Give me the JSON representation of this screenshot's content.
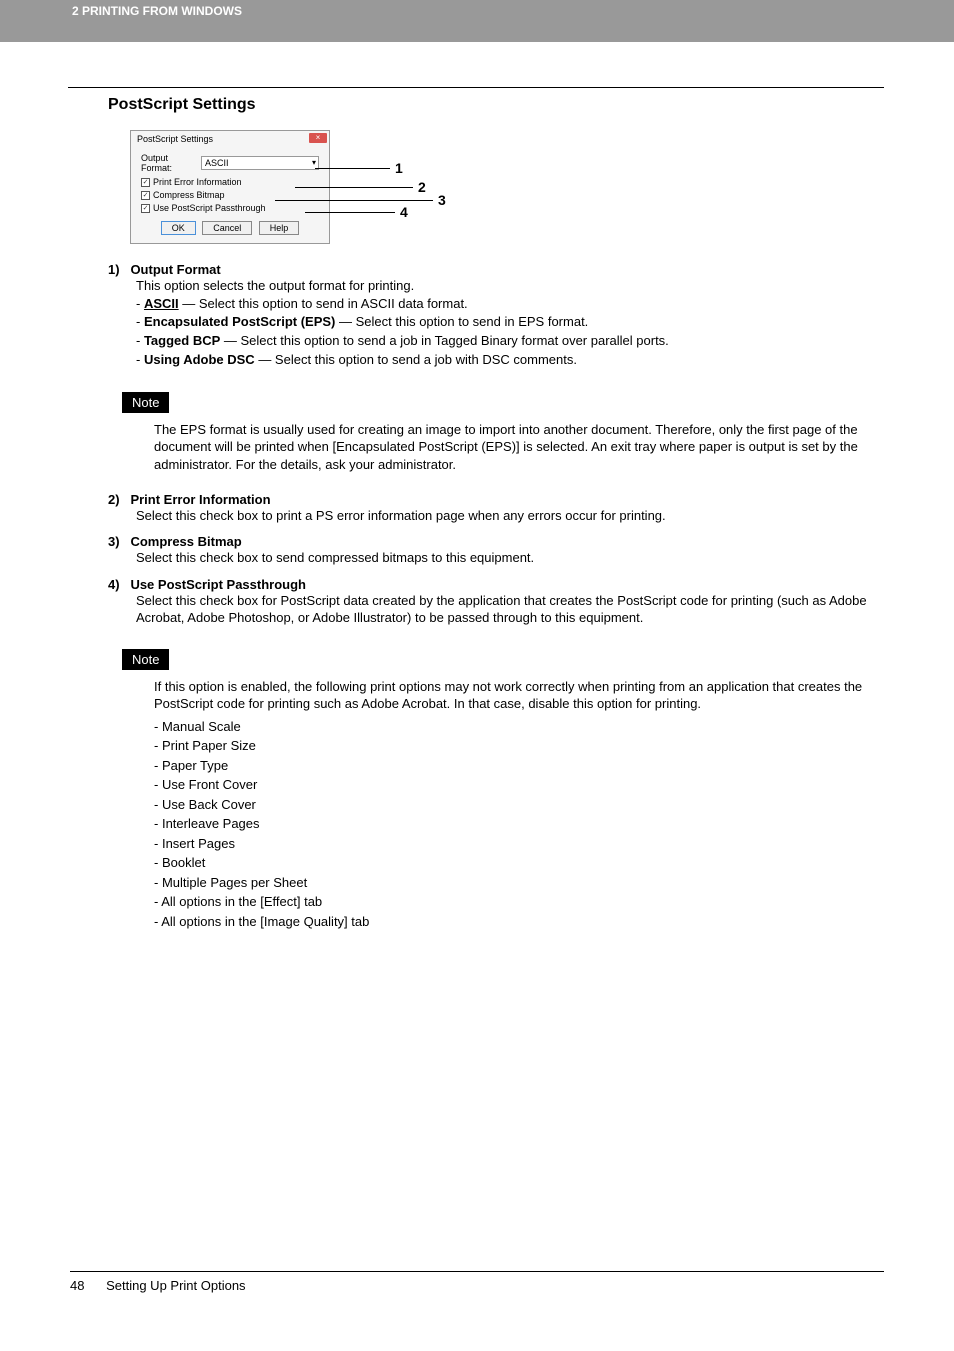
{
  "header": {
    "chapter": "2 PRINTING FROM WINDOWS"
  },
  "section_title": "PostScript Settings",
  "dialog": {
    "title": "PostScript Settings",
    "output_label": "Output Format:",
    "output_value": "ASCII",
    "chk1": "Print Error Information",
    "chk2": "Compress Bitmap",
    "chk3": "Use PostScript Passthrough",
    "btn_ok": "OK",
    "btn_cancel": "Cancel",
    "btn_help": "Help"
  },
  "callouts": {
    "n1": "1",
    "n2": "2",
    "n3": "3",
    "n4": "4"
  },
  "items": {
    "i1": {
      "num": "1)",
      "title": "Output Format",
      "desc": "This option selects the output format for printing.",
      "opts": {
        "a_name": "ASCII",
        "a_rest": " — Select this option to send in ASCII data format.",
        "b_name": "Encapsulated PostScript (EPS)",
        "b_rest": " — Select this option to send in EPS format.",
        "c_name": "Tagged BCP",
        "c_rest": " — Select this option to send a job in Tagged Binary format over parallel ports.",
        "d_name": "Using Adobe DSC",
        "d_rest": " — Select this option to send a job with DSC comments."
      },
      "note_label": "Note",
      "note_body": "The EPS format is usually used for creating an image to import into another document. Therefore, only the first page of the document will be printed when [Encapsulated PostScript (EPS)] is selected. An exit tray where paper is output is set by the administrator. For the details, ask your administrator."
    },
    "i2": {
      "num": "2)",
      "title": "Print Error Information",
      "desc": "Select this check box to print a PS error information page when any errors occur for printing."
    },
    "i3": {
      "num": "3)",
      "title": "Compress Bitmap",
      "desc": "Select this check box to send compressed bitmaps to this equipment."
    },
    "i4": {
      "num": "4)",
      "title": "Use PostScript Passthrough",
      "desc": "Select this check box for PostScript data created by the application that creates the PostScript code for printing (such as Adobe Acrobat, Adobe Photoshop, or Adobe Illustrator) to be passed through to this equipment.",
      "note_label": "Note",
      "note_body": "If this option is enabled, the following print options may not work correctly when printing from an application that creates the PostScript code for printing such as Adobe Acrobat. In that case, disable this option for printing.",
      "note_list": {
        "a": "Manual Scale",
        "b": "Print Paper Size",
        "c": "Paper Type",
        "d": "Use Front Cover",
        "e": "Use Back Cover",
        "f": "Interleave Pages",
        "g": "Insert Pages",
        "h": "Booklet",
        "i": "Multiple Pages per Sheet",
        "j": "All options in the [Effect] tab",
        "k": "All options in the [Image Quality] tab"
      }
    }
  },
  "footer": {
    "page_number": "48",
    "section": "Setting Up Print Options"
  }
}
